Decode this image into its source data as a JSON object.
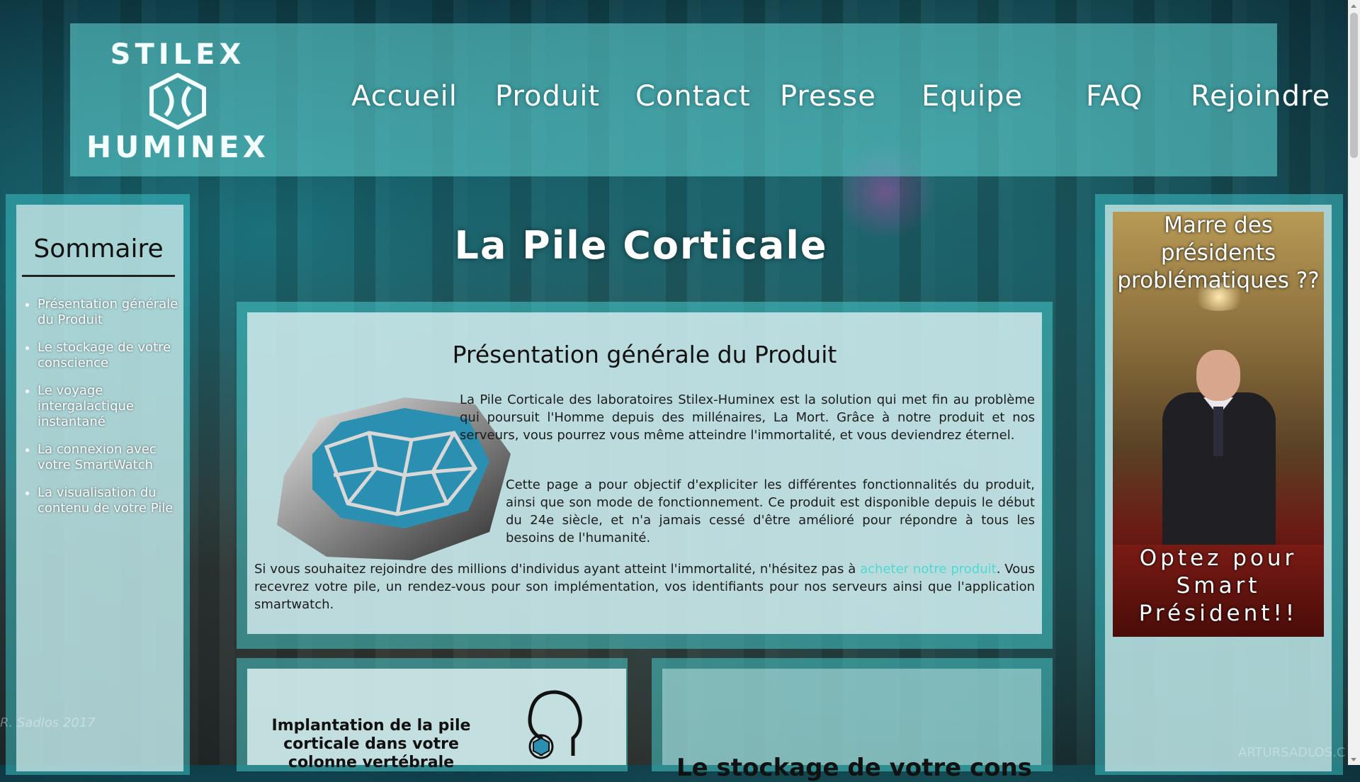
{
  "brand": {
    "line1": "STILEX",
    "line2": "HUMINEX"
  },
  "nav": {
    "items": [
      "Accueil",
      "Produit",
      "Contact",
      "Presse",
      "Equipe",
      "FAQ",
      "Rejoindre"
    ]
  },
  "sidebar": {
    "title": "Sommaire",
    "items": [
      "Présentation générale du Produit",
      "Le stockage de votre conscience",
      "Le voyage intergalactique instantané",
      "La connexion avec votre SmartWatch",
      "La visualisation du contenu de votre Pile"
    ]
  },
  "page": {
    "title": "La Pile Corticale"
  },
  "article": {
    "heading": "Présentation générale du Produit",
    "paragraph1": "La Pile Corticale des laboratoires Stilex-Huminex est la solution qui met fin au problème qui poursuit l'Homme depuis des millénaires, La Mort. Grâce à notre produit et nos serveurs, vous pourrez vous même atteindre l'immortalité, et vous deviendrez éternel.",
    "paragraph2": "Cette page a pour objectif d'expliciter les différentes fonctionnalités du produit, ainsi que son mode de fonctionnement. Ce produit est disponible depuis le début du 24e siècle, et n'a jamais cessé d'être amélioré pour répondre à tous les besoins de l'humanité.",
    "paragraph3_before": "Si vous souhaitez rejoindre des millions d'individus ayant atteint l'immortalité, n'hésitez pas à ",
    "paragraph3_link": "acheter notre produit",
    "paragraph3_after": ". Vous recevrez votre pile, un rendez-vous pour son implémentation, vos identifiants pour nos serveurs ainsi que l'application smartwatch."
  },
  "ad": {
    "top_text": "Marre des présidents problématiques ??",
    "bottom_text": "Optez pour Smart Président!!"
  },
  "cards": {
    "card1_title": "Implantation de la pile corticale dans votre colonne vertébrale",
    "card2_title": "Le stockage de votre conscience"
  },
  "watermark": "ARTURSADLOS.C",
  "signature": "R. Sadlos 2017",
  "colors": {
    "accent": "#4fd9d3",
    "panel": "#5ac8c8"
  }
}
